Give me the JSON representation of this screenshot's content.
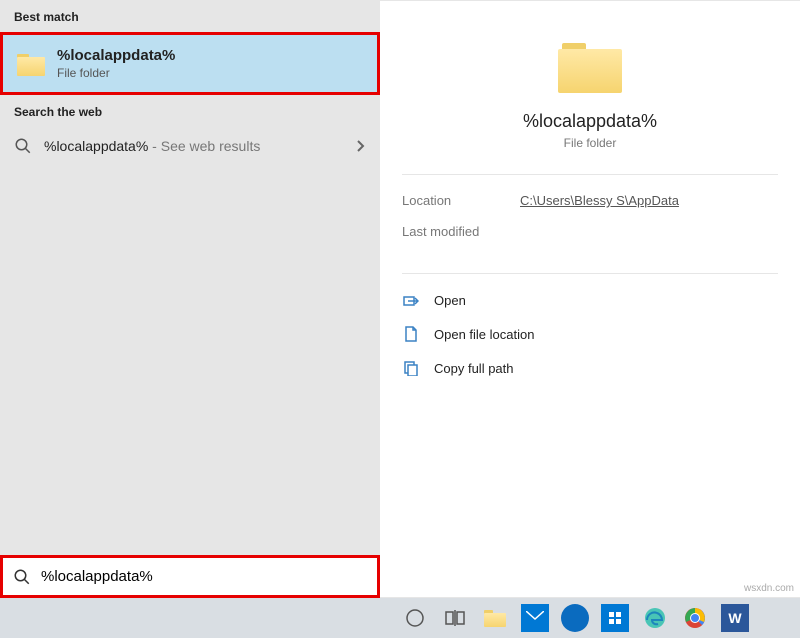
{
  "left": {
    "best_match_header": "Best match",
    "best_match": {
      "title": "%localappdata%",
      "subtitle": "File folder"
    },
    "web_header": "Search the web",
    "web_item": {
      "title": "%localappdata%",
      "suffix": " - See web results"
    },
    "search_value": "%localappdata%"
  },
  "preview": {
    "title": "%localappdata%",
    "subtitle": "File folder",
    "location_label": "Location",
    "location_value": "C:\\Users\\Blessy S\\AppData",
    "last_modified_label": "Last modified",
    "actions": {
      "open": "Open",
      "open_location": "Open file location",
      "copy_path": "Copy full path"
    }
  },
  "watermark": "wsxdn.com"
}
